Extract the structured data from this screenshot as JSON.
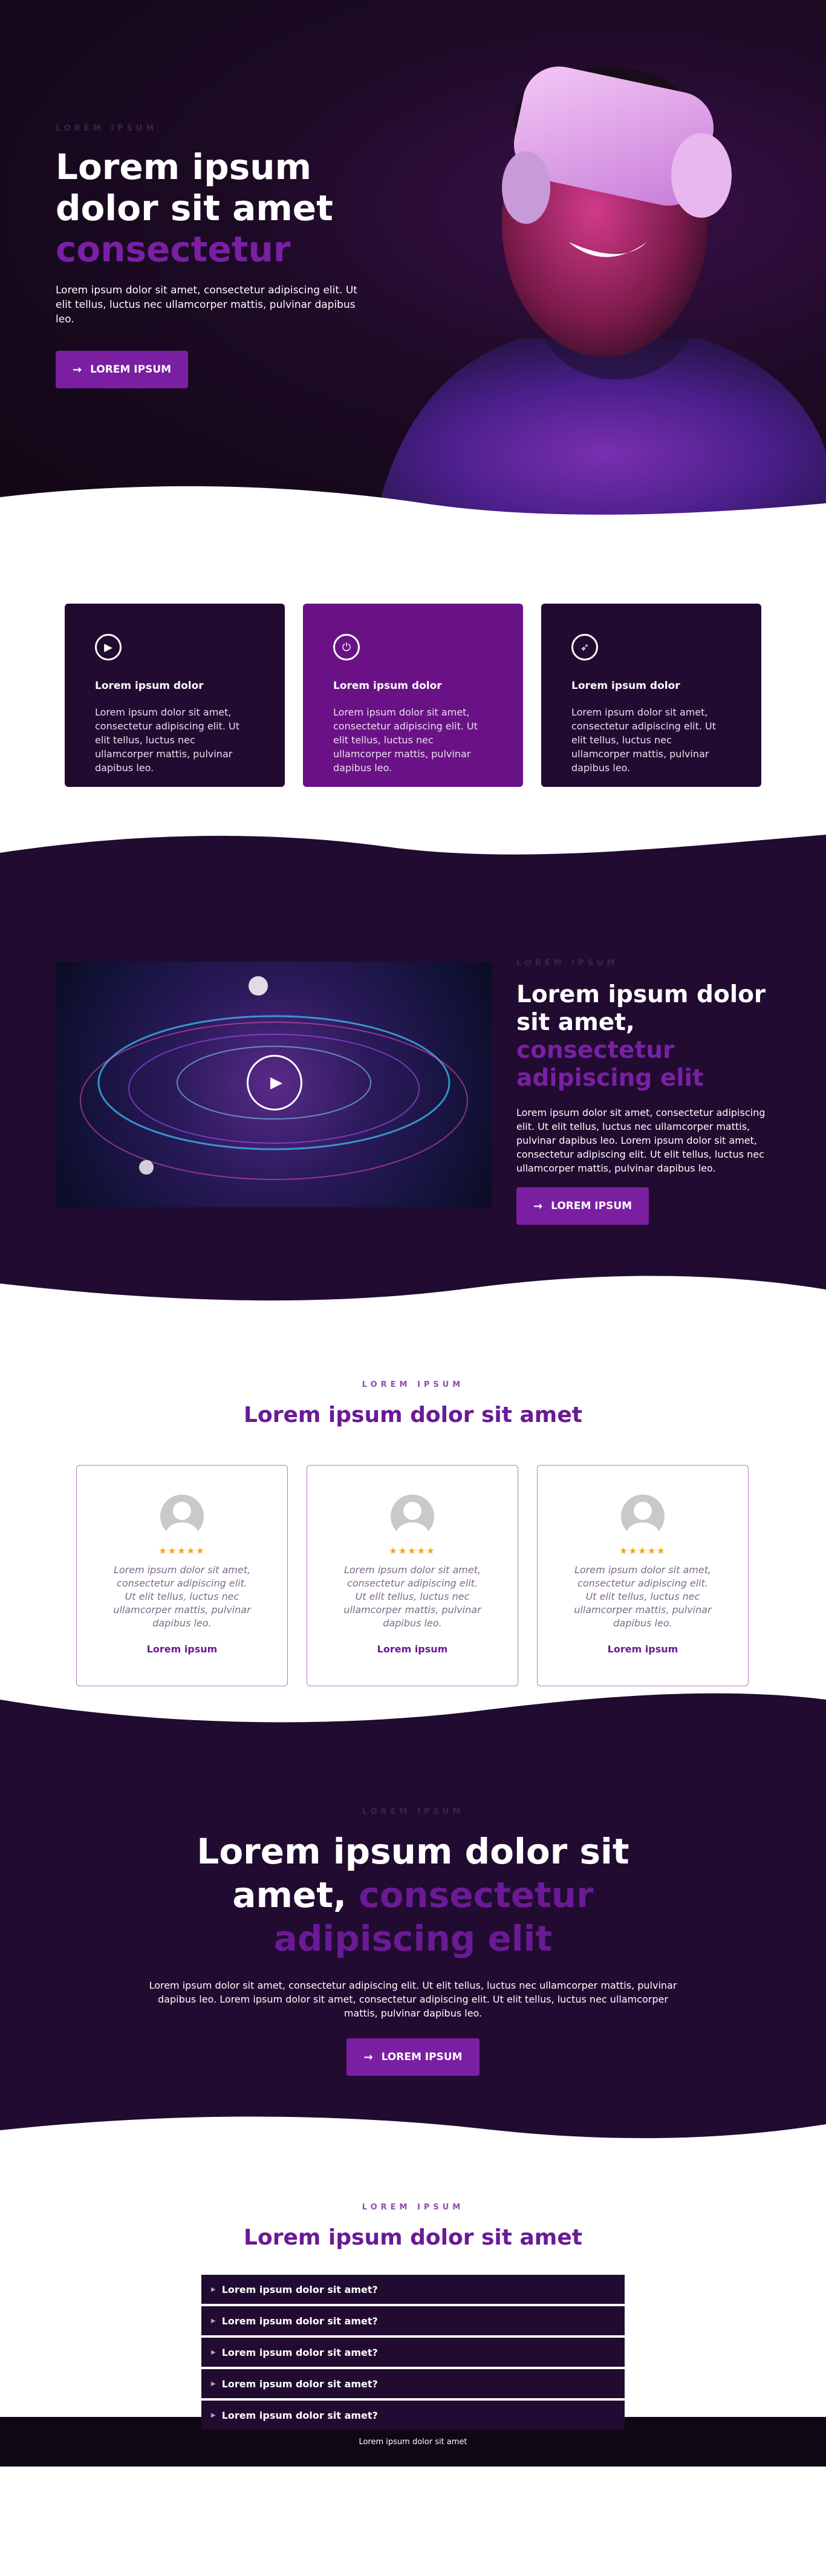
{
  "hero": {
    "eyebrow": "LOREM IPSUM",
    "title_line1": "Lorem ipsum",
    "title_line2": "dolor sit amet",
    "title_accent": "consectetur",
    "text": "Lorem ipsum dolor sit amet, consectetur adipiscing elit. Ut elit tellus, luctus nec ullamcorper mattis, pulvinar dapibus leo.",
    "button": "LOREM IPSUM"
  },
  "features": [
    {
      "icon": "play-icon",
      "title": "Lorem ipsum dolor",
      "text": "Lorem ipsum dolor sit amet, consectetur adipiscing elit. Ut elit tellus, luctus nec ullamcorper mattis, pulvinar dapibus leo."
    },
    {
      "icon": "power-icon",
      "title": "Lorem ipsum dolor",
      "text": "Lorem ipsum dolor sit amet, consectetur adipiscing elit. Ut elit tellus, luctus nec ullamcorper mattis, pulvinar dapibus leo."
    },
    {
      "icon": "rocket-icon",
      "title": "Lorem ipsum dolor",
      "text": "Lorem ipsum dolor sit amet, consectetur adipiscing elit. Ut elit tellus, luctus nec ullamcorper mattis, pulvinar dapibus leo."
    }
  ],
  "video": {
    "eyebrow": "LOREM IPSUM",
    "title_plain": "Lorem ipsum dolor sit amet, ",
    "title_accent": "consectetur adipiscing elit",
    "text": "Lorem ipsum dolor sit amet, consectetur adipiscing elit. Ut elit tellus, luctus nec ullamcorper mattis, pulvinar dapibus leo. Lorem ipsum dolor sit amet, consectetur adipiscing elit. Ut elit tellus, luctus nec ullamcorper mattis, pulvinar dapibus leo.",
    "button": "LOREM IPSUM"
  },
  "testimonials": {
    "eyebrow": "LOREM IPSUM",
    "title": "Lorem ipsum dolor sit amet",
    "stars": "★★★★★",
    "items": [
      {
        "quote": "Lorem ipsum dolor sit amet, consectetur adipiscing elit. Ut elit tellus, luctus nec ullamcorper mattis, pulvinar dapibus leo.",
        "name": "Lorem ipsum"
      },
      {
        "quote": "Lorem ipsum dolor sit amet, consectetur adipiscing elit. Ut elit tellus, luctus nec ullamcorper mattis, pulvinar dapibus leo.",
        "name": "Lorem ipsum"
      },
      {
        "quote": "Lorem ipsum dolor sit amet, consectetur adipiscing elit. Ut elit tellus, luctus nec ullamcorper mattis, pulvinar dapibus leo.",
        "name": "Lorem ipsum"
      }
    ]
  },
  "cta": {
    "eyebrow": "LOREM IPSUM",
    "title_plain": "Lorem ipsum dolor sit amet, ",
    "title_accent": "consectetur adipiscing elit",
    "text": "Lorem ipsum dolor sit amet, consectetur adipiscing elit. Ut elit tellus, luctus nec ullamcorper mattis, pulvinar dapibus leo. Lorem ipsum dolor sit amet, consectetur adipiscing elit. Ut elit tellus, luctus nec ullamcorper mattis, pulvinar dapibus leo.",
    "button": "LOREM IPSUM"
  },
  "faq": {
    "eyebrow": "LOREM IPSUM",
    "title": "Lorem ipsum dolor sit amet",
    "items": [
      "Lorem ipsum dolor sit amet?",
      "Lorem ipsum dolor sit amet?",
      "Lorem ipsum dolor sit amet?",
      "Lorem ipsum dolor sit amet?",
      "Lorem ipsum dolor sit amet?"
    ]
  },
  "footer": {
    "text": "Lorem ipsum dolor sit amet"
  },
  "colors": {
    "dark": "#210b30",
    "purple": "#7b1fa2",
    "accent_text": "#7a1fa6",
    "star": "#f0a31c"
  }
}
